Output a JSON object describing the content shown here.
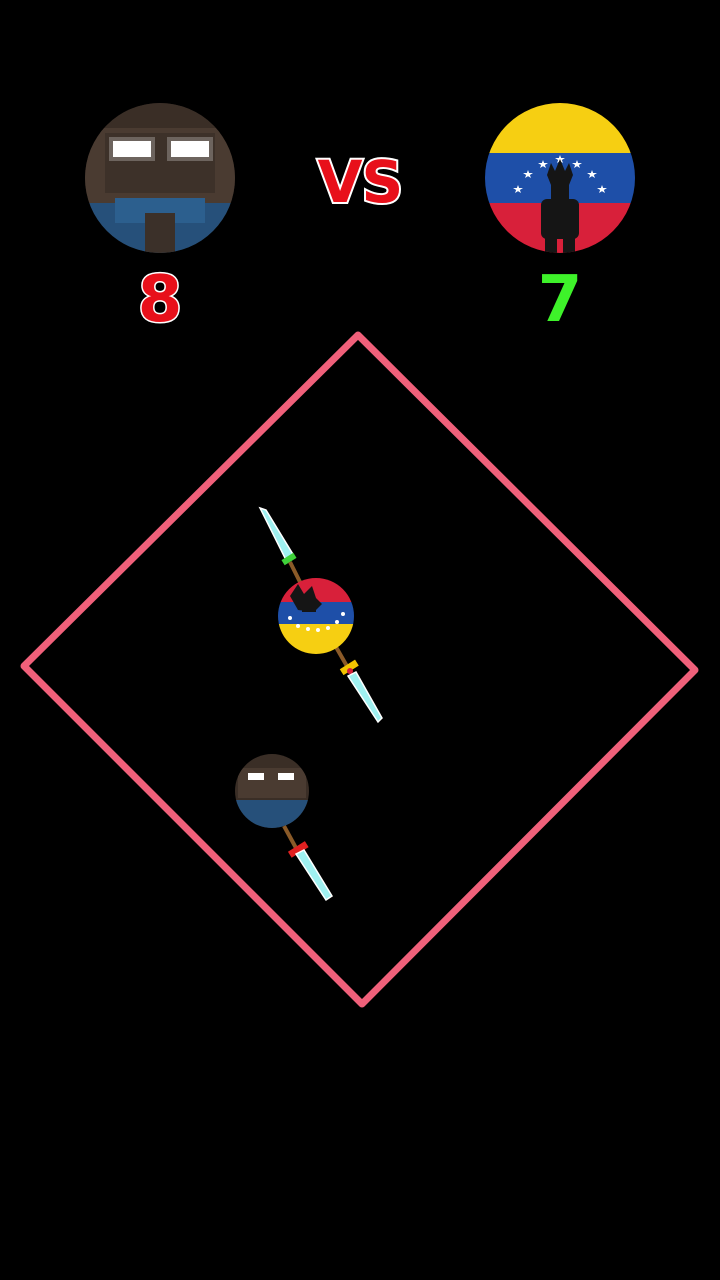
{
  "header": {
    "vs_label": "VS",
    "player1": {
      "avatar_icon": "herobrine-face-icon",
      "score": "8",
      "score_color": "#e8101a"
    },
    "player2": {
      "avatar_icon": "venezuela-flag-warrior-icon",
      "score": "7",
      "score_color": "#3ef22a"
    }
  },
  "arena": {
    "shape": "diamond",
    "border_color": "#f0607a"
  },
  "fighters": [
    {
      "name": "herobrine-ball",
      "icon": "herobrine-face-icon",
      "weapon": "sword-icon",
      "weapon_guard_color": "#e02020"
    },
    {
      "name": "venezuela-ball",
      "icon": "venezuela-flag-warrior-icon",
      "weapon": "double-sword-icon",
      "weapon_guard_colors": [
        "#3fd13a",
        "#f2c400"
      ]
    }
  ]
}
